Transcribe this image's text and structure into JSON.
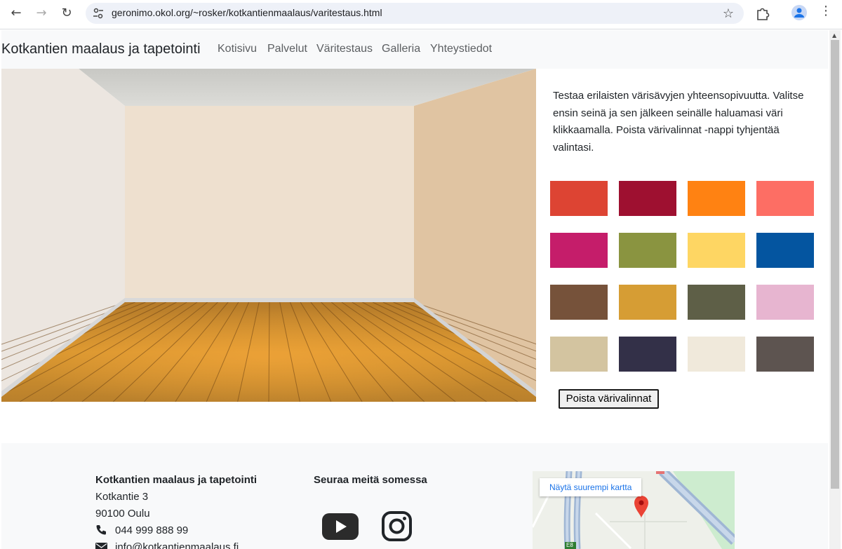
{
  "browser": {
    "url": "geronimo.okol.org/~rosker/kotkantienmaalaus/varitestaus.html"
  },
  "navbar": {
    "brand": "Kotkantien maalaus ja tapetointi",
    "links": [
      "Kotisivu",
      "Palvelut",
      "Väritestaus",
      "Galleria",
      "Yhteystiedot"
    ]
  },
  "intro": {
    "text": "Testaa erilaisten värisävyjen yhteensopivuutta. Valitse ensin seinä ja sen jälkeen seinälle haluamasi väri klikkaamalla. Poista värivalinnat -nappi tyhjentää valintasi."
  },
  "room": {
    "left_wall": "#ece6e0",
    "back_wall": "#eee0cf",
    "right_wall": "#e0c4a2",
    "ceiling": "#cfcfcb",
    "floor": "#c98a2f"
  },
  "swatches": [
    "#dd4433",
    "#9e1030",
    "#ff8212",
    "#fd6e64",
    "#c51d6a",
    "#8a9440",
    "#fed663",
    "#0455a0",
    "#76523a",
    "#d69d34",
    "#5e5f47",
    "#e7b5d0",
    "#d3c4a0",
    "#333048",
    "#f0e9db",
    "#5d5450"
  ],
  "clear_button": "Poista värivalinnat",
  "footer": {
    "company": {
      "name": "Kotkantien maalaus ja tapetointi",
      "street": "Kotkantie 3",
      "city": "90100 Oulu",
      "phone": "044 999 888 99",
      "email": "info@kotkantienmaalaus.fi"
    },
    "social": {
      "heading": "Seuraa meitä somessa",
      "icons": [
        "youtube-icon",
        "instagram-icon"
      ]
    },
    "map": {
      "button": "Näytä suurempi kartta",
      "road_label": "E8"
    }
  }
}
